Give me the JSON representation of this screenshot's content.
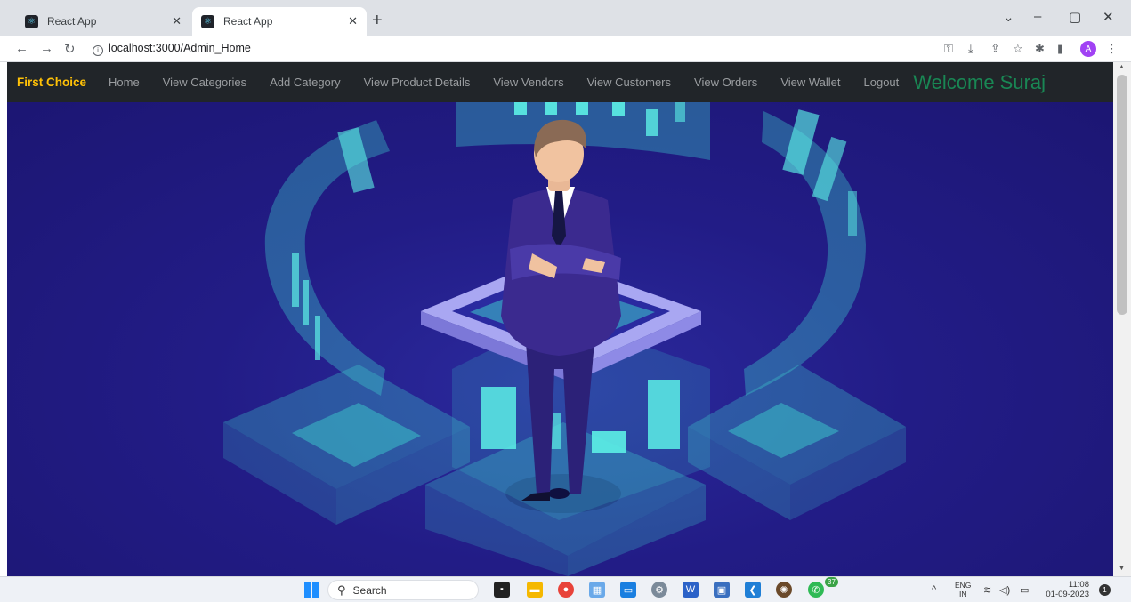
{
  "browser": {
    "tabs": [
      {
        "title": "React App",
        "active": false
      },
      {
        "title": "React App",
        "active": true
      }
    ],
    "url": "localhost:3000/Admin_Home",
    "profile_initial": "A"
  },
  "navbar": {
    "brand": "First Choice",
    "links": [
      "Home",
      "View Categories",
      "Add Category",
      "View Product Details",
      "View Vendors",
      "View Customers",
      "View Orders",
      "View Wallet",
      "Logout"
    ],
    "welcome": "Welcome Suraj",
    "colors": {
      "background": "#212529",
      "brand": "#ffc107",
      "welcome": "#198754",
      "link": "#9a9da0"
    }
  },
  "hero": {
    "colors": {
      "background": "#221c86",
      "accent": "#3fd8d0",
      "platform": "#a9a7f2",
      "suit": "#3b2a8f"
    }
  },
  "taskbar": {
    "search_placeholder": "Search",
    "whatsapp_badge": "37",
    "language_top": "ENG",
    "language_bottom": "IN",
    "time": "11:08",
    "date": "01-09-2023",
    "notifications": "1"
  }
}
